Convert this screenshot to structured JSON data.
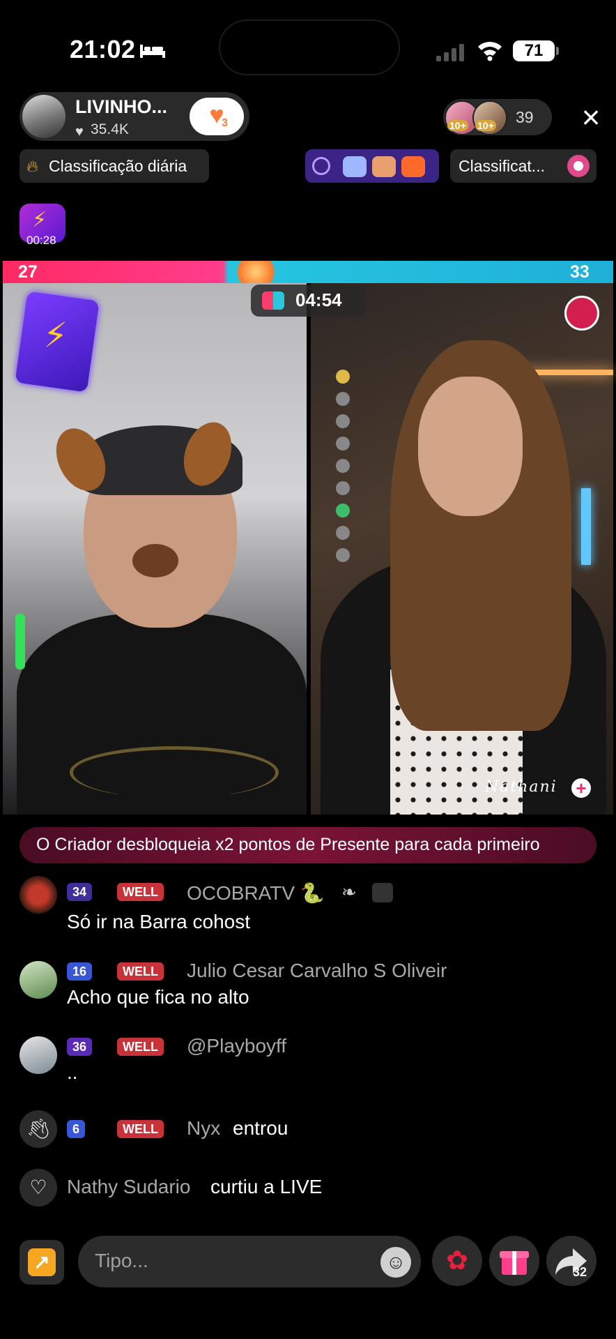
{
  "status_bar": {
    "time": "21:02",
    "battery": "71"
  },
  "host": {
    "name": "LIVINHO...",
    "likes": "35.4K",
    "heart_count": "3"
  },
  "viewers": {
    "count": "39",
    "avatar_badges": [
      "10+",
      "10+"
    ]
  },
  "chips": {
    "daily_ranking": "Classificação diária",
    "ranking_short": "Classificat..."
  },
  "boost": {
    "timer": "00:28"
  },
  "battle": {
    "score_left": "27",
    "score_right": "33",
    "timer": "04:54",
    "left_share": 0.45,
    "guest_name": "Nathani"
  },
  "banner": {
    "text": "O Criador desbloqueia x2 pontos de Presente para cada primeiro"
  },
  "chat": [
    {
      "level": "34",
      "badge": "WELL",
      "user": "OCOBRATV 🐍",
      "text": "Só ir na Barra cohost"
    },
    {
      "level": "16",
      "badge": "WELL",
      "user": "Julio Cesar Carvalho S Oliveir",
      "text": "Acho que fica no alto"
    },
    {
      "level": "36",
      "badge": "WELL",
      "user": "@Playboyff",
      "text": ".."
    },
    {
      "level": "6",
      "badge": "WELL",
      "user": "Nyx",
      "action": "entrou"
    },
    {
      "user": "Nathy Sudario",
      "action": "curtiu a LIVE"
    }
  ],
  "input": {
    "placeholder": "Tipo..."
  },
  "share": {
    "count": "32"
  },
  "colors": {
    "battle_pink": "#ff2a63",
    "battle_cyan": "#26c6e0",
    "well_badge": "#c8333a",
    "level_badge": "#3c2f9a"
  },
  "icons": [
    "bed-icon",
    "wifi-icon",
    "heart-icon",
    "close-icon",
    "fire-icon",
    "boost-icon",
    "boxing-glove-icon",
    "smile-icon",
    "rose-icon",
    "gift-icon",
    "share-arrow-icon",
    "wave-icon"
  ]
}
